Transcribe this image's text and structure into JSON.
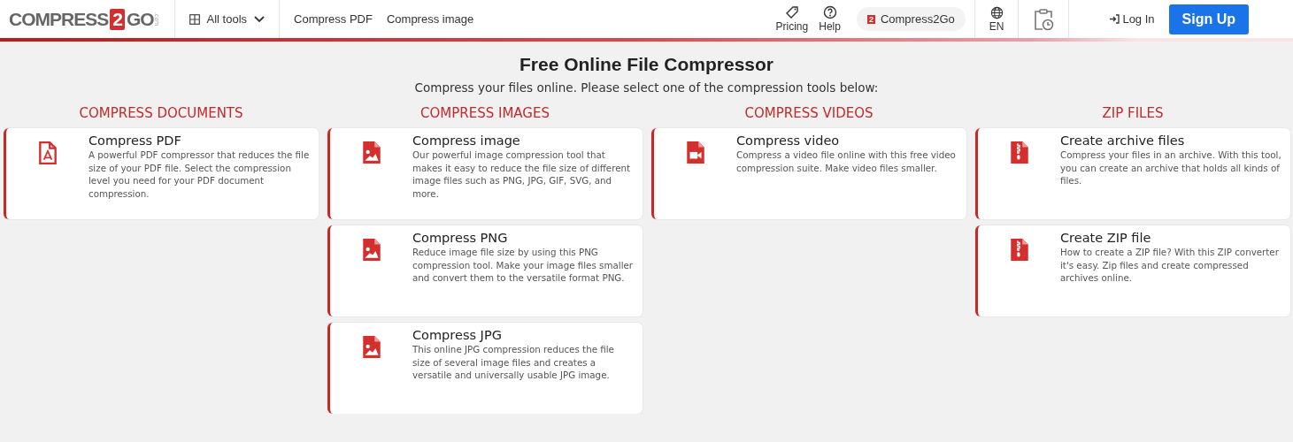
{
  "header": {
    "logo": {
      "left": "COMPRESS",
      "badge": "2",
      "right": "GO",
      "suffix": ".com"
    },
    "all_tools": "All tools",
    "nav_links": [
      "Compress PDF",
      "Compress image"
    ],
    "icon_links": [
      {
        "kind": "tag",
        "label": "Pricing"
      },
      {
        "kind": "help",
        "label": "Help"
      }
    ],
    "brand_pill": {
      "badge": "2",
      "label": "Compress2Go"
    },
    "language": "EN",
    "login": "Log In",
    "signup": "Sign Up"
  },
  "title": "Free Online File Compressor",
  "subtitle": "Compress your files online. Please select one of the compression tools below:",
  "columns": [
    {
      "heading": "COMPRESS DOCUMENTS",
      "cards": [
        {
          "kind": "pdf",
          "title": "Compress PDF",
          "text": "A powerful PDF compressor that reduces the file size of your PDF file. Select the compression level you need for your PDF document compression."
        }
      ]
    },
    {
      "heading": "COMPRESS IMAGES",
      "cards": [
        {
          "kind": "image",
          "title": "Compress image",
          "text": "Our powerful image compression tool that makes it easy to reduce the file size of different image files such as PNG, JPG, GIF, SVG, and more."
        },
        {
          "kind": "image",
          "title": "Compress PNG",
          "text": "Reduce image file size by using this PNG compression tool. Make your image files smaller and convert them to the versatile format PNG."
        },
        {
          "kind": "image",
          "title": "Compress JPG",
          "text": "This online JPG compression reduces the file size of several image files and creates a versatile and universally usable JPG image."
        }
      ]
    },
    {
      "heading": "COMPRESS VIDEOS",
      "cards": [
        {
          "kind": "video",
          "title": "Compress video",
          "text": "Compress a video file online with this free video compression suite. Make video files smaller."
        }
      ]
    },
    {
      "heading": "ZIP FILES",
      "cards": [
        {
          "kind": "zip",
          "title": "Create archive files",
          "text": "Compress your files in an archive. With this tool, you can create an archive that holds all kinds of files."
        },
        {
          "kind": "zip",
          "title": "Create ZIP file",
          "text": "How to create a ZIP file? With this ZIP converter it's easy. Zip files and create compressed archives online."
        }
      ]
    }
  ]
}
